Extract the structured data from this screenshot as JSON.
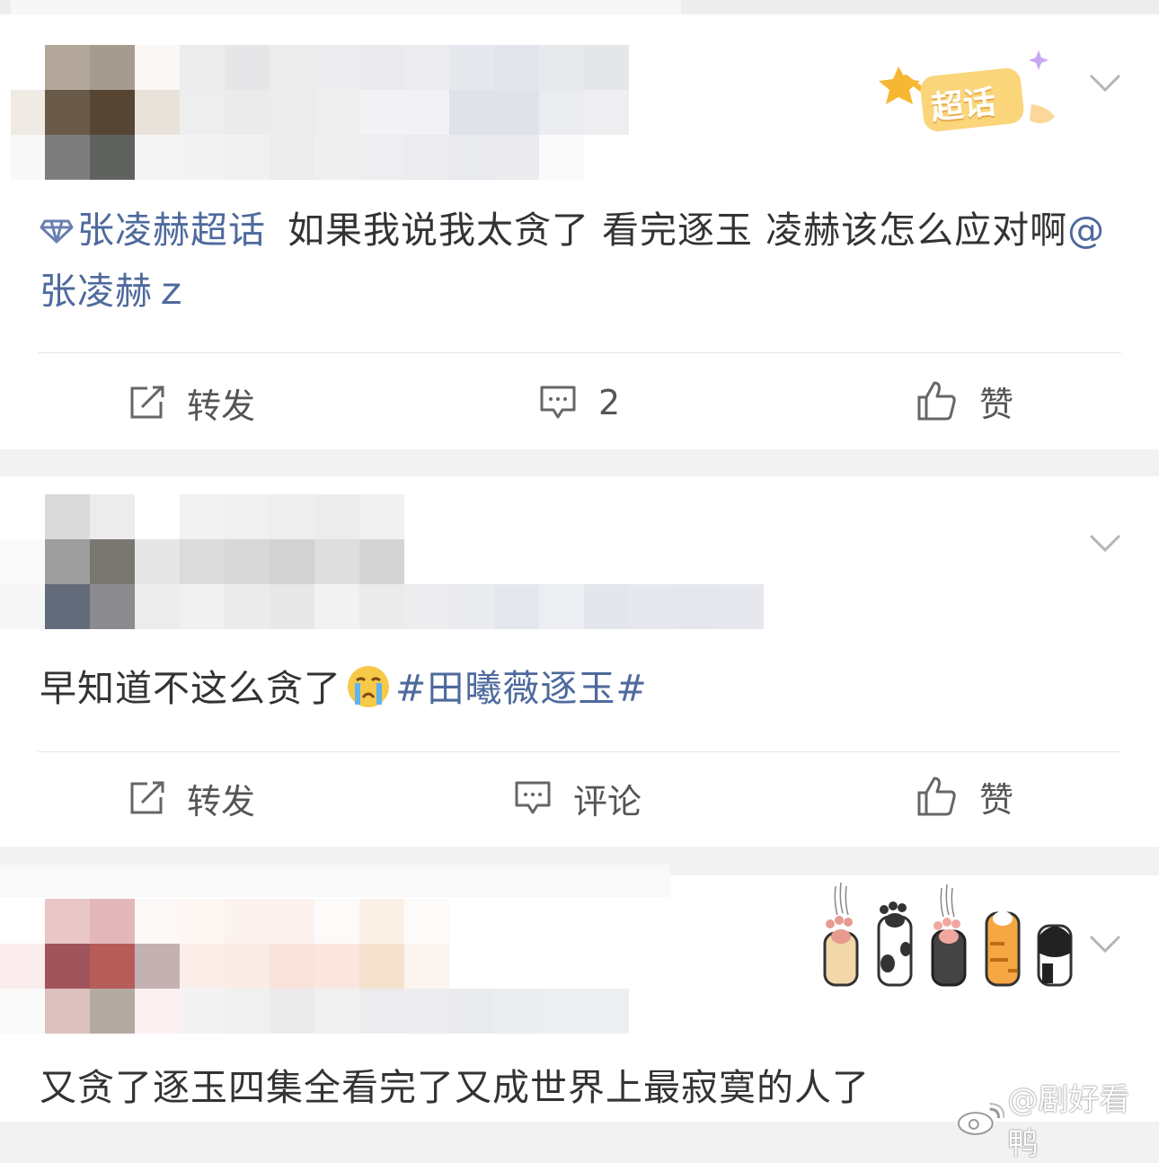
{
  "posts": [
    {
      "super_topic": "张凌赫超话",
      "text": "如果我说我太贪了 看完逐玉 凌赫该怎么应对啊",
      "mention": "@张凌赫ｚ",
      "badge": "超话",
      "actions": {
        "repost": "转发",
        "comment": "2",
        "like": "赞"
      }
    },
    {
      "text": "早知道不这么贪了",
      "emoji": "crying-face",
      "topic": "#田曦薇逐玉#",
      "actions": {
        "repost": "转发",
        "comment": "评论",
        "like": "赞"
      }
    },
    {
      "text": "又贪了逐玉四集全看完了又成世界上最寂寞的人了"
    }
  ],
  "watermark": "@剧好看鸭",
  "colors": {
    "link": "#4e6a9d",
    "text": "#333333",
    "background": "#f2f2f2"
  }
}
